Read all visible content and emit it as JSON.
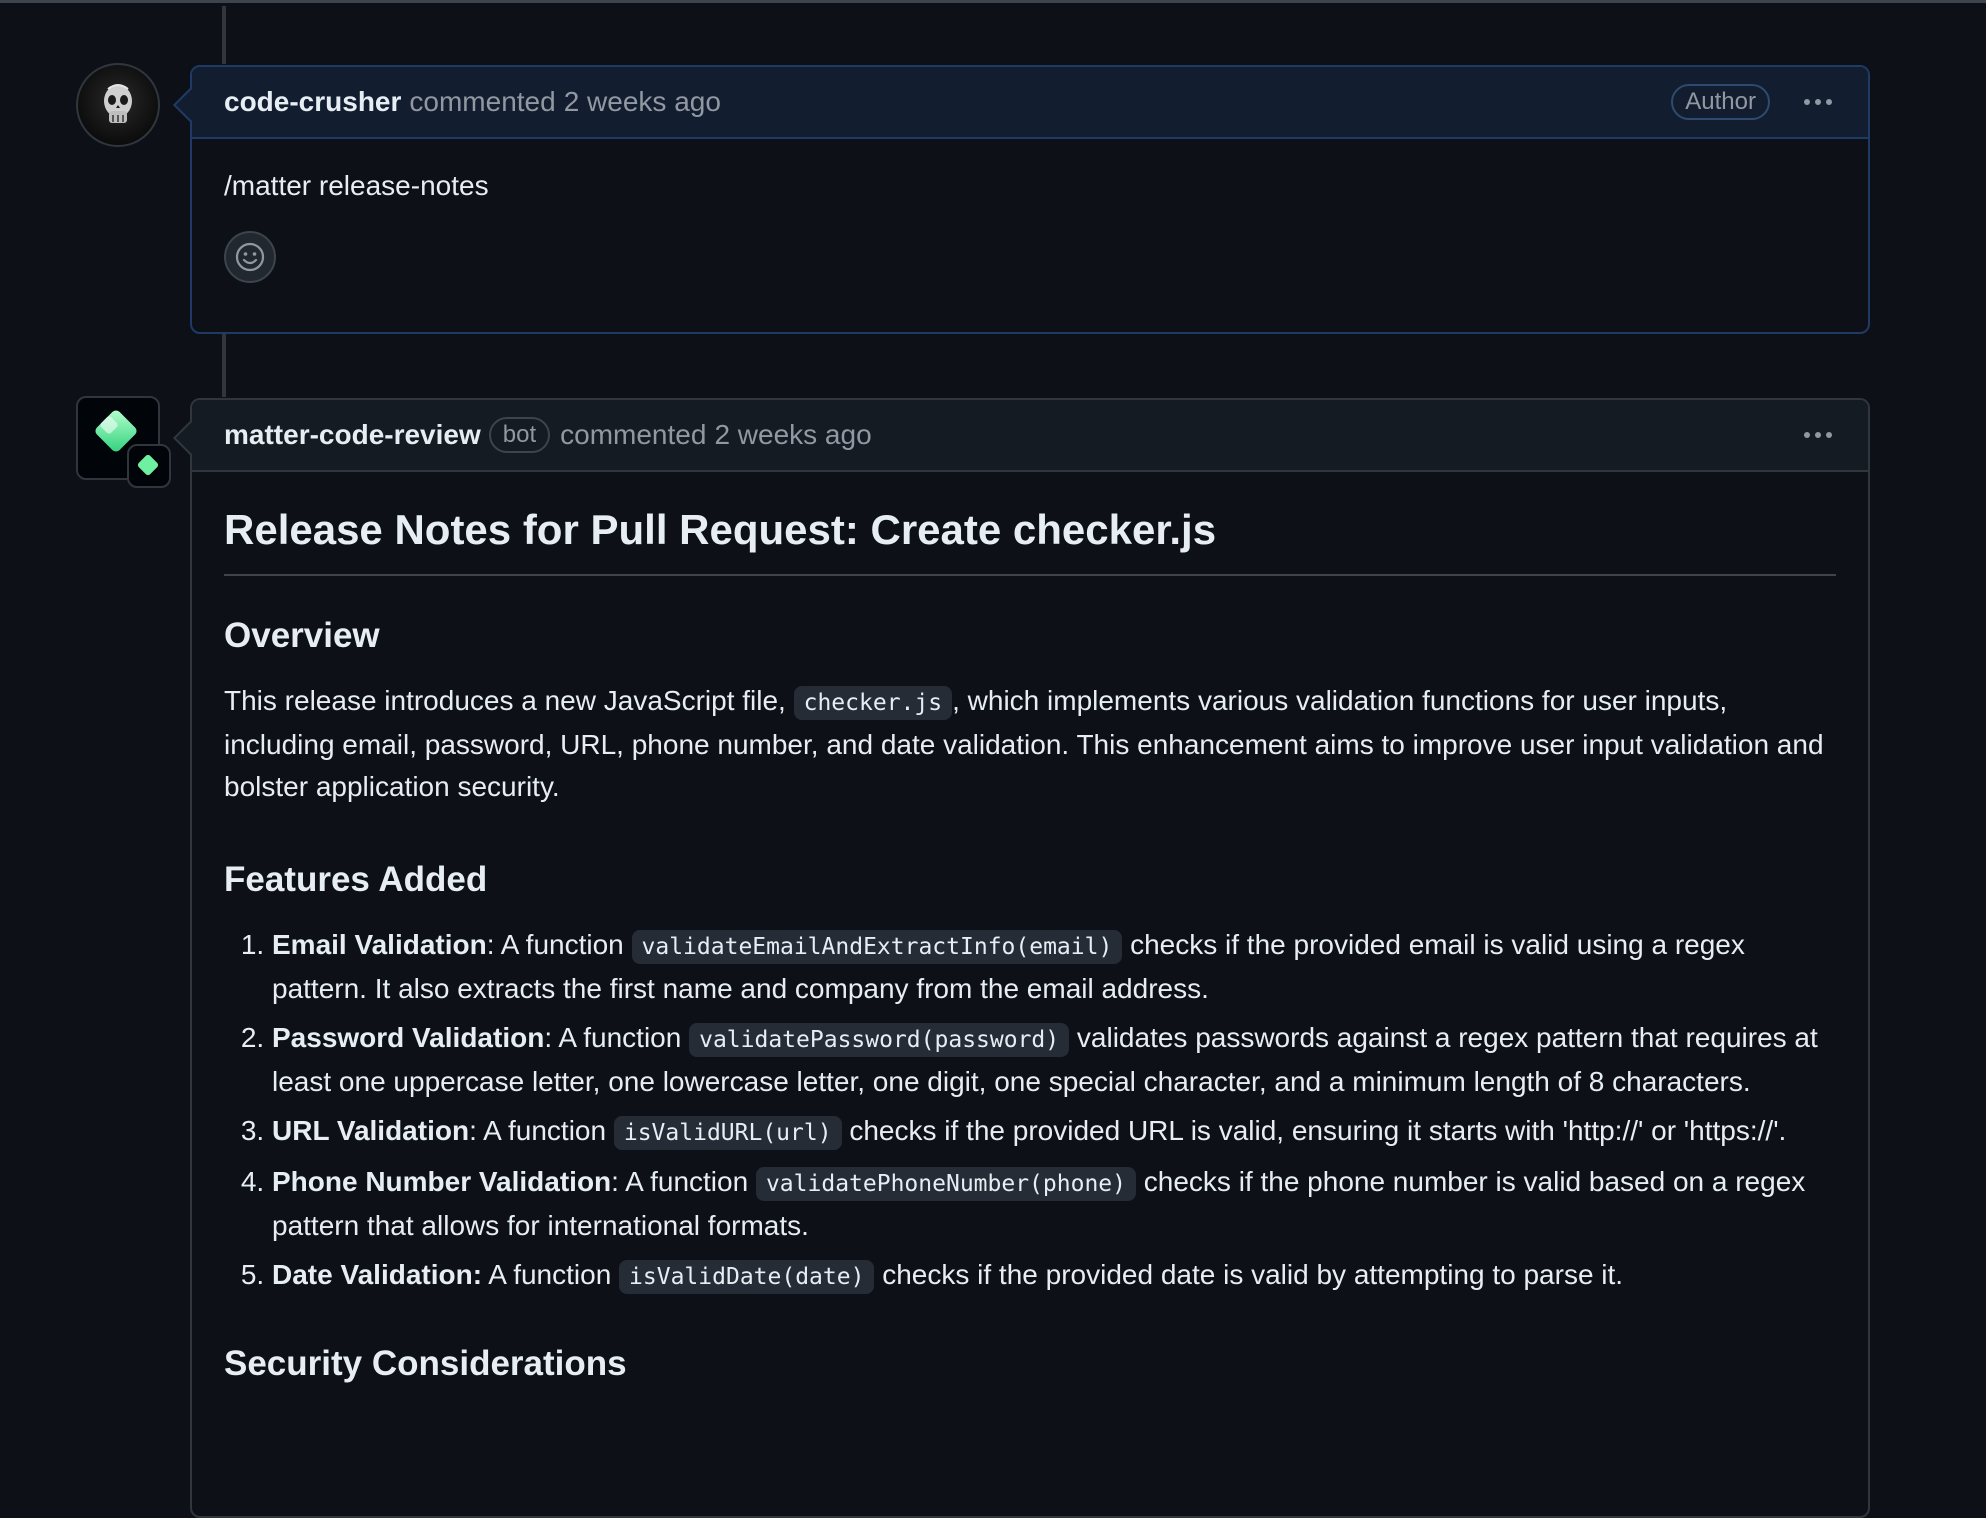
{
  "comments": [
    {
      "username": "code-crusher",
      "action": "commented",
      "time": "2 weeks ago",
      "badge": "Author",
      "body": "/matter release-notes"
    },
    {
      "username": "matter-code-review",
      "bot_label": "bot",
      "action": "commented",
      "time": "2 weeks ago",
      "release_notes": {
        "title": "Release Notes for Pull Request: Create checker.js",
        "overview_heading": "Overview",
        "overview_before": "This release introduces a new JavaScript file, ",
        "overview_code": "checker.js",
        "overview_after": ", which implements various validation functions for user inputs, including email, password, URL, phone number, and date validation. This enhancement aims to improve user input validation and bolster application security.",
        "features_heading": "Features Added",
        "features": [
          {
            "name": "Email Validation",
            "sep": ": A function ",
            "code": "validateEmailAndExtractInfo(email)",
            "rest": " checks if the provided email is valid using a regex pattern. It also extracts the first name and company from the email address."
          },
          {
            "name": "Password Validation",
            "sep": ": A function ",
            "code": "validatePassword(password)",
            "rest": " validates passwords against a regex pattern that requires at least one uppercase letter, one lowercase letter, one digit, one special character, and a minimum length of 8 characters."
          },
          {
            "name": "URL Validation",
            "sep": ": A function ",
            "code": "isValidURL(url)",
            "rest": " checks if the provided URL is valid, ensuring it starts with 'http://' or 'https://'."
          },
          {
            "name": "Phone Number Validation",
            "sep": ": A function ",
            "code": "validatePhoneNumber(phone)",
            "rest": " checks if the phone number is valid based on a regex pattern that allows for international formats."
          },
          {
            "name": "Date Validation:",
            "sep": " A function ",
            "code": "isValidDate(date)",
            "rest": " checks if the provided date is valid by attempting to parse it."
          }
        ],
        "security_heading": "Security Considerations"
      }
    }
  ],
  "icons": {
    "user_avatar": "skull-avatar-icon",
    "bot_avatar": "matter-diamond-logo-icon",
    "emoji": "smiley-face-icon",
    "menu": "kebab-menu-icon"
  },
  "colors": {
    "background": "#0d1117",
    "author_border": "#1f3a64",
    "bot_logo_green": "#6ef0a0"
  }
}
